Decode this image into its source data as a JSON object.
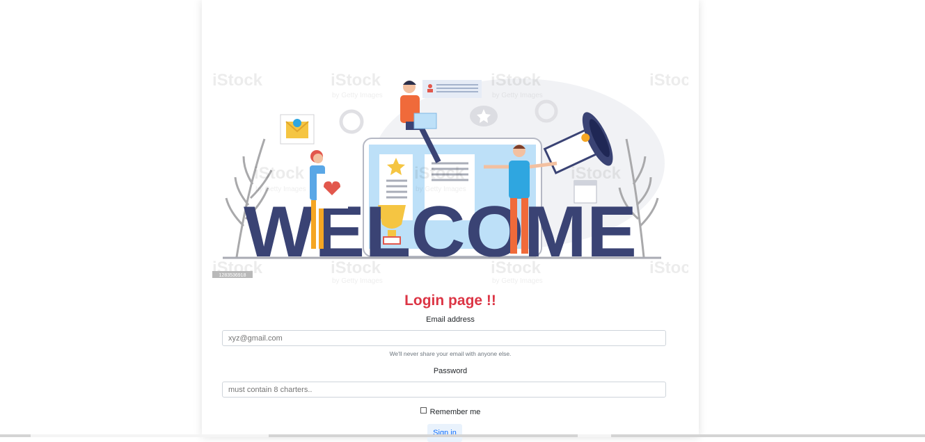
{
  "login": {
    "title": "Login page !!",
    "email_label": "Email address",
    "email_placeholder": "xyz@gmail.com",
    "email_help": "We'll never share your email with anyone else.",
    "password_label": "Password",
    "password_placeholder": "must contain 8 charters..",
    "remember_label": "Remember me",
    "submit_label": "Sign in"
  },
  "hero": {
    "word": "WELCOME",
    "watermark": "iStock",
    "watermark_sub": "by Getty Images",
    "image_id": "1283536918"
  },
  "colors": {
    "title": "#dc3545",
    "welcome_text": "#3a4374",
    "button_text": "#0d6efd"
  }
}
